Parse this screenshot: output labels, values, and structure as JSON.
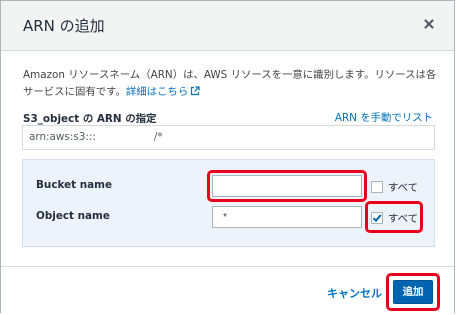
{
  "dialog": {
    "title": "ARN の追加",
    "close_icon": "close-icon"
  },
  "description": {
    "text": "Amazon リソースネーム（ARN）は、AWS リソースを一意に識別します。リソースは各サービスに固有です。",
    "link": "詳細はこちら",
    "link_icon": "external-link-icon"
  },
  "arn": {
    "label": "S3_object の ARN の指定",
    "manual_link": "ARN を手動でリスト",
    "value_prefix": "arn:aws:s3:::",
    "value_suffix": "/*"
  },
  "bucket": {
    "label": "Bucket name",
    "value": "",
    "all_label": "すべて",
    "all_checked": false
  },
  "object": {
    "label": "Object name",
    "value": "*",
    "all_label": "すべて",
    "all_checked": true
  },
  "footer": {
    "cancel_label": "キャンセル",
    "add_label": "追加"
  },
  "colors": {
    "accent": "#0073bb",
    "primary_button": "#0064b0",
    "highlight": "#e8001c",
    "panel_bg": "#edf3fb"
  }
}
